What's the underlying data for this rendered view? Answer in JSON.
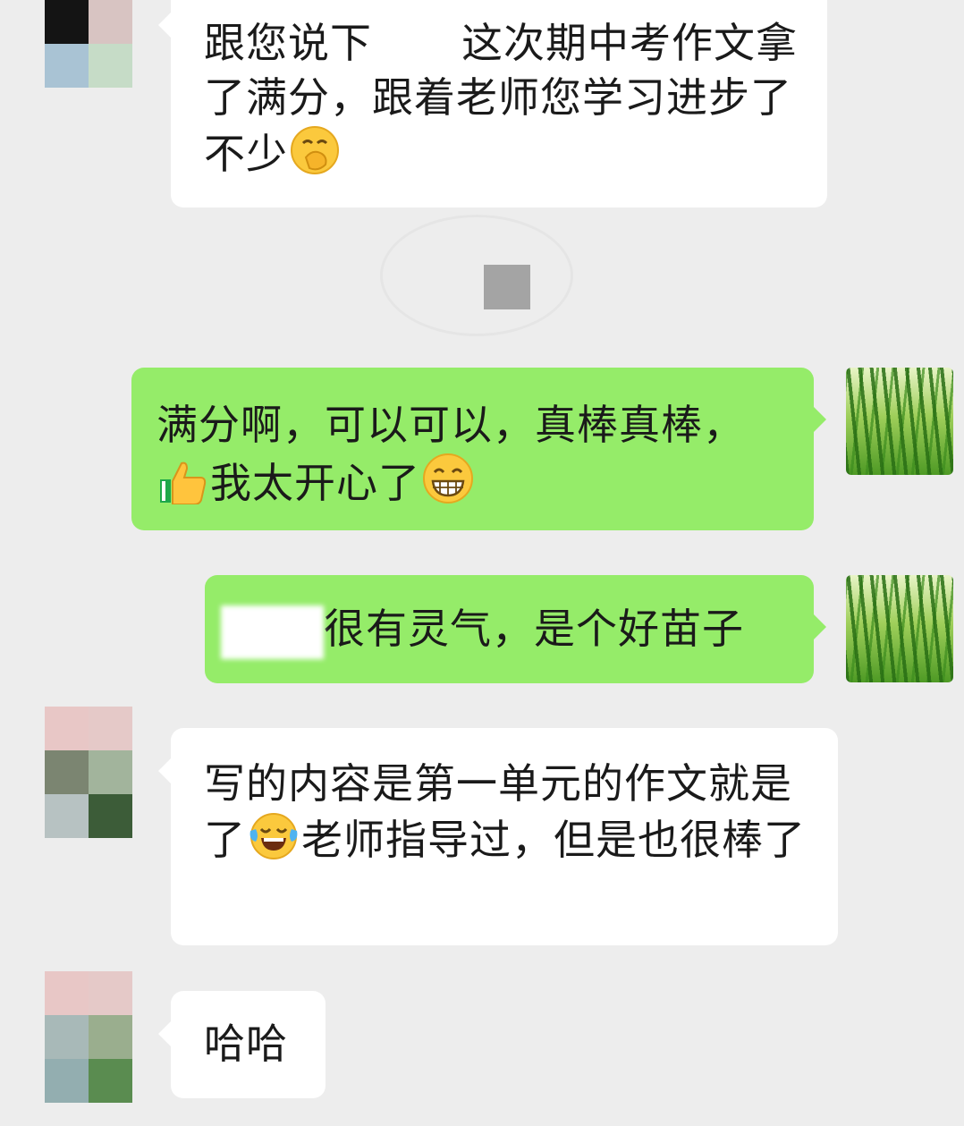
{
  "messages": [
    {
      "sender": "other",
      "avatar_colors": [
        "#141414",
        "#d8c4c2",
        "#a9c3d4",
        "#c6dcc7"
      ],
      "text_before": "跟您说下",
      "text_after": "这次期中考作文拿了满分，跟着老师您学习进步了不少",
      "emoji": "face-with-hand-over-mouth-emoji"
    },
    {
      "sender": "me",
      "text_line1": "满分啊，可以可以，真棒真棒，",
      "text_line2": "我太开心了",
      "emoji_lead": "thumbs-up-emoji",
      "emoji_end": "grinning-face-emoji"
    },
    {
      "sender": "me",
      "text": "很有灵气，是个好苗子"
    },
    {
      "sender": "other",
      "avatar_colors": [
        "#e8c7c6",
        "#e5c9c8",
        "#7b8571",
        "#a2b49c",
        "#b7c2c2",
        "#3c5c38"
      ],
      "text_before": "写的内容是第一单元的作文就是了",
      "text_after": "老师指导过，但是也很棒了",
      "emoji": "tears-of-joy-emoji"
    },
    {
      "sender": "other",
      "avatar_colors": [
        "#e8c7c6",
        "#e5c9c8",
        "#a8b9b8",
        "#9aae8e",
        "#93aeb0",
        "#5a8c50"
      ],
      "text": "哈哈"
    }
  ],
  "colors": {
    "background": "#ededed",
    "bubble_incoming": "#ffffff",
    "bubble_outgoing": "#95ec69"
  }
}
